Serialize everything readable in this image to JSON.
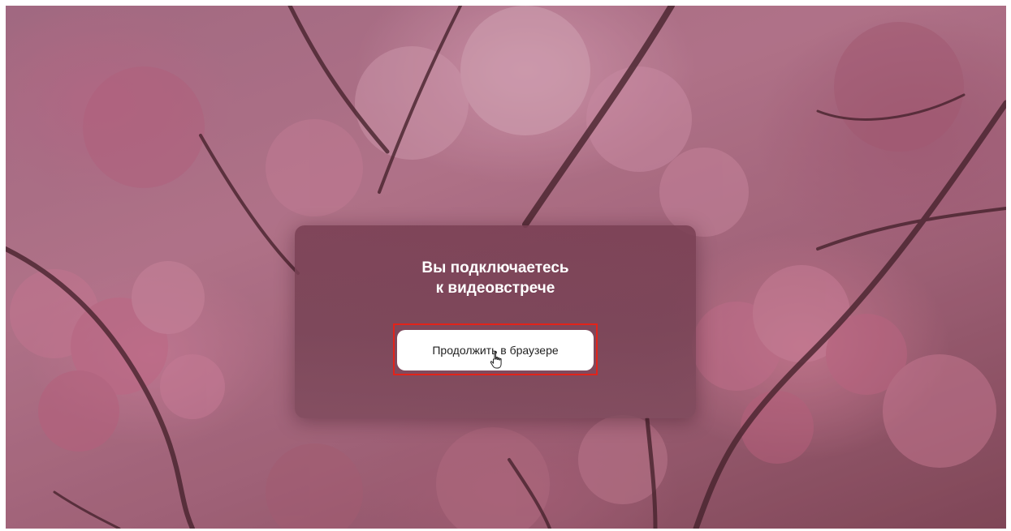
{
  "background": {
    "description_icon": "cherry-blossom-photo",
    "tint": "#c9869f"
  },
  "dialog": {
    "title": "Вы подключаетесь\nк видеовстрече",
    "continue_button": "Продолжить в браузере",
    "highlight_color": "#e2231a"
  },
  "cursor": {
    "icon": "hand-pointer-icon"
  }
}
